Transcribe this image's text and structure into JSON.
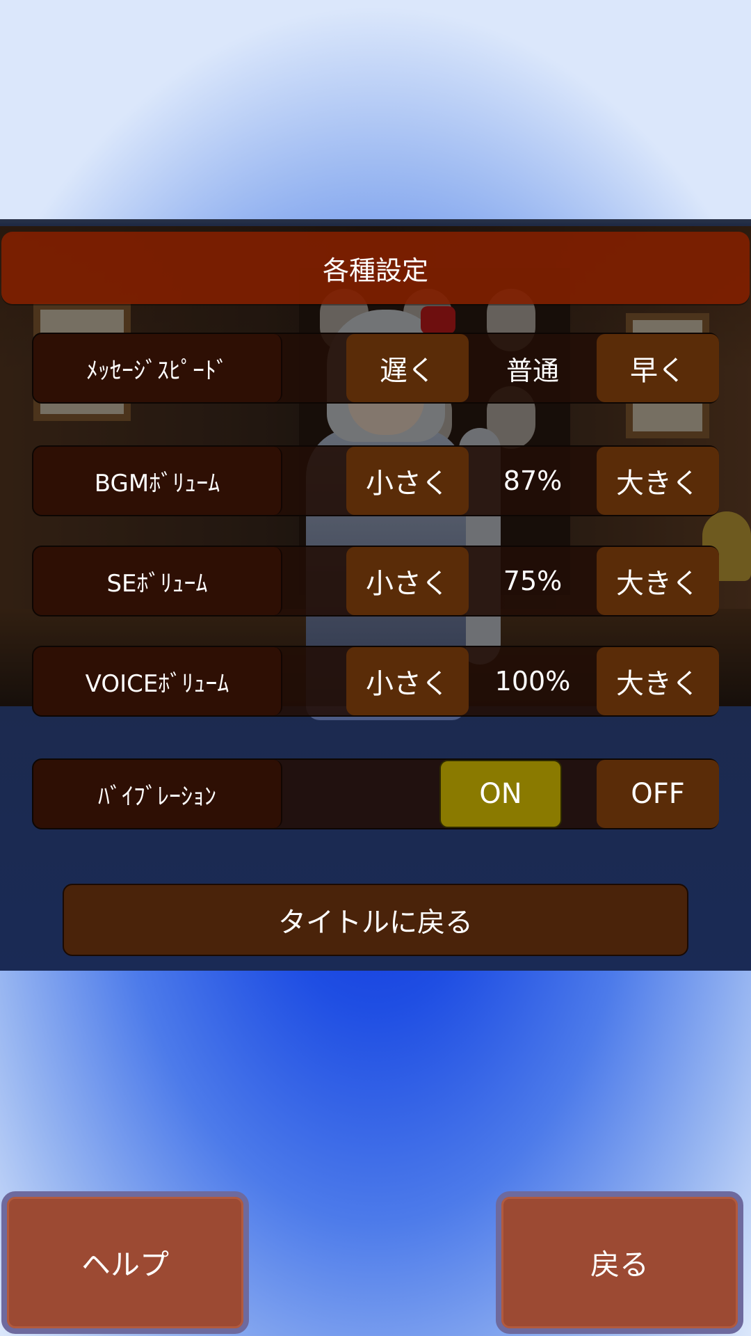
{
  "panel": {
    "title": "各種設定"
  },
  "settings": {
    "message_speed": {
      "label": "ﾒｯｾｰｼﾞｽﾋﾟｰﾄﾞ",
      "left_button": "遅く",
      "value": "普通",
      "right_button": "早く"
    },
    "bgm_volume": {
      "label": "BGMﾎﾞﾘｭｰﾑ",
      "left_button": "小さく",
      "value": "87%",
      "right_button": "大きく"
    },
    "se_volume": {
      "label": "SEﾎﾞﾘｭｰﾑ",
      "left_button": "小さく",
      "value": "75%",
      "right_button": "大きく"
    },
    "voice_volume": {
      "label": "VOICEﾎﾞﾘｭｰﾑ",
      "left_button": "小さく",
      "value": "100%",
      "right_button": "大きく"
    },
    "vibration": {
      "label": "ﾊﾞｲﾌﾞﾚｰｼｮﾝ",
      "on_button": "ON",
      "off_button": "OFF",
      "selected": "ON"
    }
  },
  "return_to_title": "タイトルに戻る",
  "footer": {
    "help_label": "ヘルプ",
    "back_label": "戻る"
  },
  "colors": {
    "header": "#802000",
    "button": "#5a2c08",
    "selected_toggle": "#8a7a00",
    "bottom_button": "#9c4a33"
  }
}
